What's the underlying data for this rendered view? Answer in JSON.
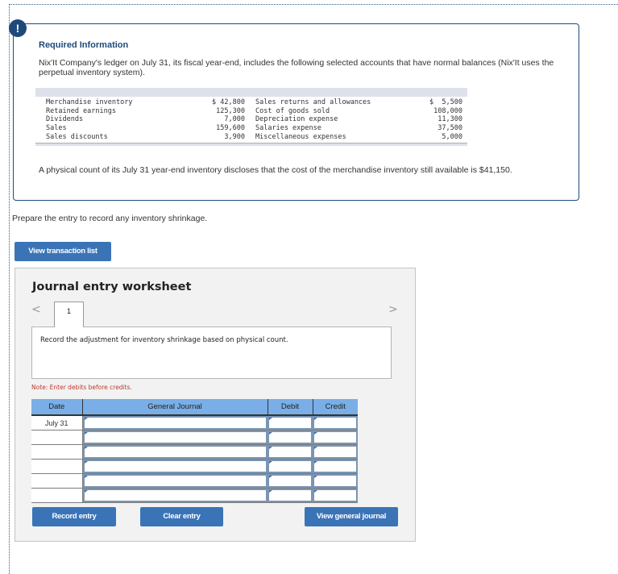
{
  "alert": {
    "icon": "!"
  },
  "info": {
    "title": "Required Information",
    "text": "Nix'It Company's ledger on July 31, its fiscal year-end, includes the following selected accounts that have normal balances (Nix'It uses the perpetual inventory system).",
    "accounts": [
      {
        "left_name": "Merchandise inventory",
        "left_amount": "$ 42,800",
        "right_name": "Sales returns and allowances",
        "right_amount": "$  5,500"
      },
      {
        "left_name": "Retained earnings",
        "left_amount": "125,300",
        "right_name": "Cost of goods sold",
        "right_amount": "108,000"
      },
      {
        "left_name": "Dividends",
        "left_amount": "7,000",
        "right_name": "Depreciation expense",
        "right_amount": "11,300"
      },
      {
        "left_name": "Sales",
        "left_amount": "159,600",
        "right_name": "Salaries expense",
        "right_amount": "37,500"
      },
      {
        "left_name": "Sales discounts",
        "left_amount": "3,900",
        "right_name": "Miscellaneous expenses",
        "right_amount": "5,000"
      }
    ],
    "count_text": "A physical count of its July 31 year-end inventory discloses that the cost of the merchandise inventory still available is $41,150."
  },
  "prompt": "Prepare the entry to record any inventory shrinkage.",
  "buttons": {
    "view_transaction_list": "View transaction list",
    "record_entry": "Record entry",
    "clear_entry": "Clear entry",
    "view_general_journal": "View general journal"
  },
  "worksheet": {
    "title": "Journal entry worksheet",
    "prev_icon": "<",
    "next_icon": ">",
    "tab_label": "1",
    "instruction": "Record the adjustment for inventory shrinkage based on physical count.",
    "note": "Note: Enter debits before credits.",
    "columns": [
      "Date",
      "General Journal",
      "Debit",
      "Credit"
    ],
    "rows": [
      {
        "date": "July 31",
        "account": "",
        "debit": "",
        "credit": ""
      },
      {
        "date": "",
        "account": "",
        "debit": "",
        "credit": ""
      },
      {
        "date": "",
        "account": "",
        "debit": "",
        "credit": ""
      },
      {
        "date": "",
        "account": "",
        "debit": "",
        "credit": ""
      },
      {
        "date": "",
        "account": "",
        "debit": "",
        "credit": ""
      },
      {
        "date": "",
        "account": "",
        "debit": "",
        "credit": ""
      }
    ]
  }
}
